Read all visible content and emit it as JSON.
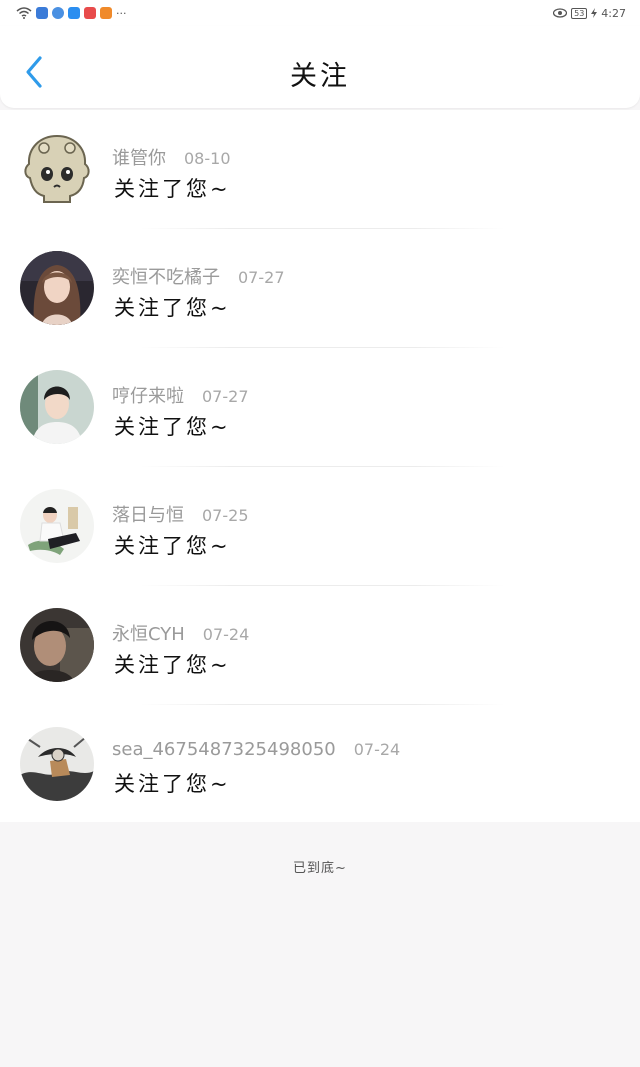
{
  "status_bar": {
    "time": "4:27",
    "battery": "53",
    "more": "···"
  },
  "header": {
    "title": "关注"
  },
  "notifications": [
    {
      "username": "谁管你",
      "date": "08-10",
      "message": "关注了您~"
    },
    {
      "username": "奕恒不吃橘子",
      "date": "07-27",
      "message": "关注了您~"
    },
    {
      "username": "哼仔来啦",
      "date": "07-27",
      "message": "关注了您~"
    },
    {
      "username": "落日与恒",
      "date": "07-25",
      "message": "关注了您~"
    },
    {
      "username": "永恒CYH",
      "date": "07-24",
      "message": "关注了您~"
    },
    {
      "username": "sea_4675487325498050",
      "date": "07-24",
      "message": "关注了您~"
    }
  ],
  "footer": {
    "end_text": "已到底~"
  },
  "colors": {
    "accent": "#2f9bea",
    "background": "#f7f6f7"
  }
}
